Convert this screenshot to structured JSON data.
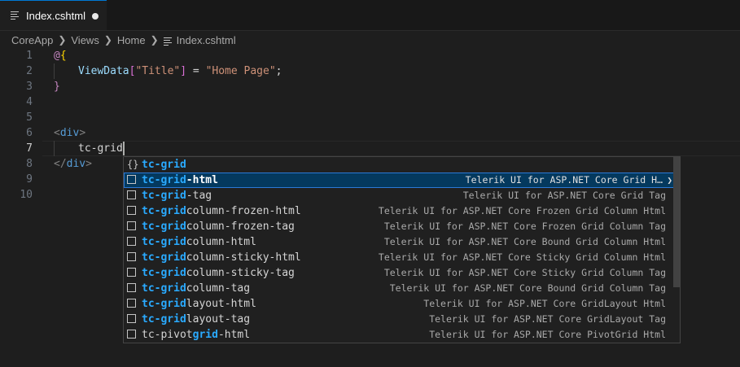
{
  "tab": {
    "filename": "Index.cshtml",
    "icon": "lines-file-icon",
    "modified": true
  },
  "breadcrumb": [
    "CoreApp",
    "Views",
    "Home",
    "Index.cshtml"
  ],
  "editor": {
    "lines": [
      {
        "n": "1"
      },
      {
        "n": "2"
      },
      {
        "n": "3"
      },
      {
        "n": "4"
      },
      {
        "n": "5"
      },
      {
        "n": "6"
      },
      {
        "n": "7"
      },
      {
        "n": "8"
      },
      {
        "n": "9"
      },
      {
        "n": "10"
      }
    ],
    "code": {
      "l1_at": "@",
      "l1_brace": "{",
      "l2_var": "ViewData",
      "l2_b1": "[",
      "l2_key": "\"Title\"",
      "l2_b2": "]",
      "l2_eq": " = ",
      "l2_val": "\"Home Page\"",
      "l2_semi": ";",
      "l3_brace": "}",
      "l6_open": "<",
      "l6_tag": "div",
      "l6_close": ">",
      "l7_text": "tc-grid",
      "l8_open": "</",
      "l8_tag": "div",
      "l8_close": ">"
    }
  },
  "suggestions": [
    {
      "icon": "snippet-braces-icon",
      "pre": "",
      "match": "tc-grid",
      "rest": "",
      "detail": ""
    },
    {
      "icon": "snippet-box-icon",
      "pre": "",
      "match": "tc-grid",
      "rest": "-html",
      "detail": "Telerik UI for ASP.NET Core Grid H…",
      "selected": true
    },
    {
      "icon": "snippet-box-icon",
      "pre": "",
      "match": "tc-grid",
      "rest": "-tag",
      "detail": "Telerik UI for ASP.NET Core Grid Tag"
    },
    {
      "icon": "snippet-box-icon",
      "pre": "",
      "match": "tc-grid",
      "rest": "column-frozen-html",
      "detail": "Telerik UI for ASP.NET Core Frozen Grid Column Html"
    },
    {
      "icon": "snippet-box-icon",
      "pre": "",
      "match": "tc-grid",
      "rest": "column-frozen-tag",
      "detail": "Telerik UI for ASP.NET Core Frozen Grid Column Tag"
    },
    {
      "icon": "snippet-box-icon",
      "pre": "",
      "match": "tc-grid",
      "rest": "column-html",
      "detail": "Telerik UI for ASP.NET Core Bound Grid Column Html"
    },
    {
      "icon": "snippet-box-icon",
      "pre": "",
      "match": "tc-grid",
      "rest": "column-sticky-html",
      "detail": "Telerik UI for ASP.NET Core Sticky Grid Column Html"
    },
    {
      "icon": "snippet-box-icon",
      "pre": "",
      "match": "tc-grid",
      "rest": "column-sticky-tag",
      "detail": "Telerik UI for ASP.NET Core Sticky Grid Column Tag"
    },
    {
      "icon": "snippet-box-icon",
      "pre": "",
      "match": "tc-grid",
      "rest": "column-tag",
      "detail": "Telerik UI for ASP.NET Core Bound Grid Column Tag"
    },
    {
      "icon": "snippet-box-icon",
      "pre": "",
      "match": "tc-grid",
      "rest": "layout-html",
      "detail": "Telerik UI for ASP.NET Core GridLayout Html"
    },
    {
      "icon": "snippet-box-icon",
      "pre": "",
      "match": "tc-grid",
      "rest": "layout-tag",
      "detail": "Telerik UI for ASP.NET Core GridLayout Tag"
    },
    {
      "icon": "snippet-box-icon",
      "pre": "tc-pivot",
      "match": "grid",
      "rest": "-html",
      "detail": "Telerik UI for ASP.NET Core PivotGrid Html"
    }
  ]
}
